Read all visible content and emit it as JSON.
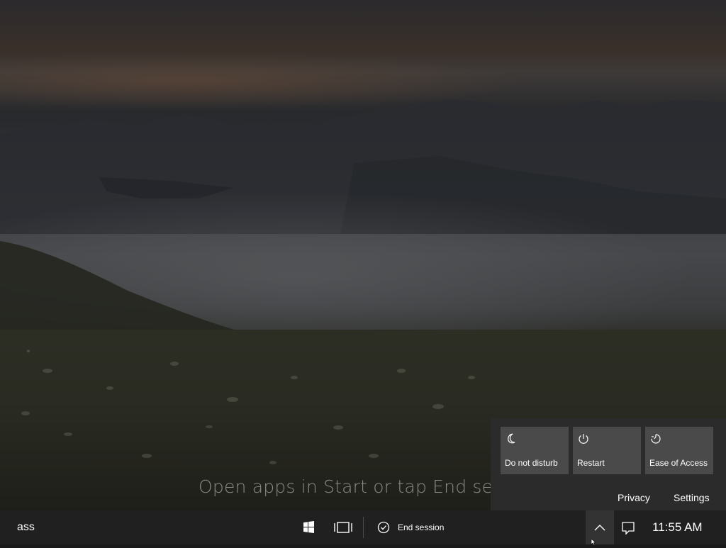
{
  "desktop": {
    "hint_text": "Open apps in Start or tap End ses"
  },
  "action_center": {
    "tiles": [
      {
        "label": "Do not disturb",
        "icon": "moon-icon"
      },
      {
        "label": "Restart",
        "icon": "power-icon"
      },
      {
        "label": "Ease of Access",
        "icon": "ease-of-access-icon"
      }
    ],
    "links": {
      "privacy": "Privacy",
      "settings": "Settings"
    }
  },
  "taskbar": {
    "search_text": "ass",
    "start_icon": "windows-start-icon",
    "task_view_icon": "task-view-icon",
    "end_session_label": "End session",
    "end_session_icon": "check-circle-icon",
    "tray_chevron_icon": "chevron-up-icon",
    "notifications_icon": "notification-icon",
    "clock": "11:55 AM"
  },
  "colors": {
    "taskbar_bg": "#202020",
    "panel_bg": "#2b2b2b",
    "tile_bg": "#4a4a4a",
    "text": "#ffffff"
  }
}
